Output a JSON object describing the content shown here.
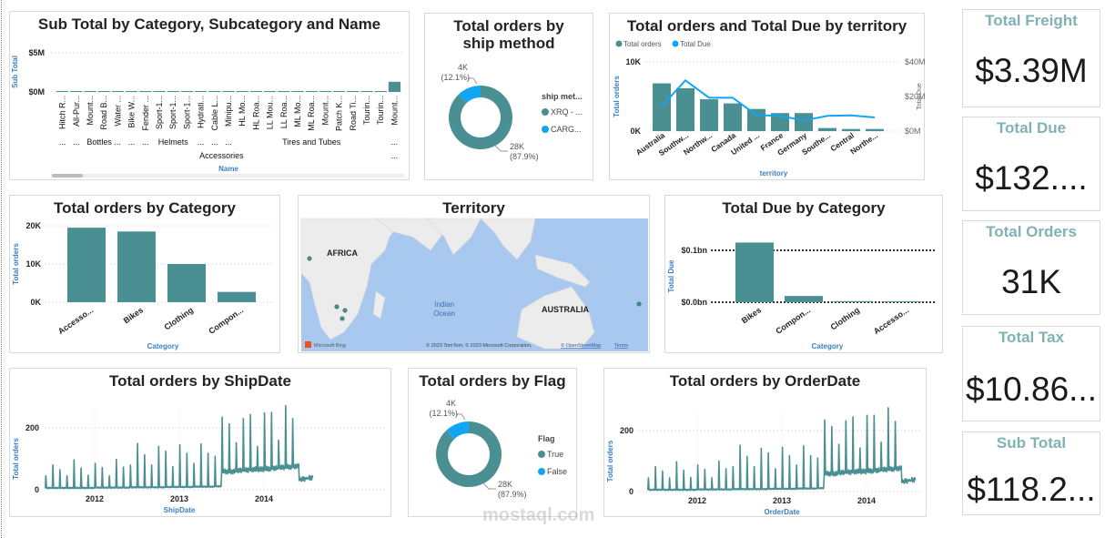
{
  "colors": {
    "teal": "#4a8f92",
    "blue": "#12a5f4",
    "title": "#252423",
    "axis_title": "#3b7fc4",
    "kpi_title": "#7fb2b4",
    "map_water": "#a9c8f0",
    "map_land": "#ececec"
  },
  "subtotal": {
    "title": "Sub Total by Category, Subcategory and Name",
    "y_title": "Sub Total",
    "x_title": "Name",
    "y_ticks": [
      "$5M",
      "$0M"
    ],
    "chart_data": {
      "type": "bar",
      "ylim": [
        0,
        5000000
      ],
      "categories": [
        "Hitch R...",
        "All-Pur...",
        "Mount...",
        "Road B...",
        "Water ...",
        "Bike W...",
        "Fender ...",
        "Sport-1...",
        "Sport-1...",
        "Sport-1...",
        "Hydrati...",
        "Cable L...",
        "Minipu...",
        "HL Mo...",
        "HL Roa...",
        "LL Mou...",
        "LL Roa...",
        "ML Mo...",
        "ML Roa...",
        "Mount...",
        "Patch K...",
        "Road Ti...",
        "Tourin...",
        "Tourin...",
        "Mount..."
      ],
      "values": [
        90000,
        10000,
        10000,
        10000,
        10000,
        10000,
        10000,
        50000,
        50000,
        50000,
        30000,
        10000,
        10000,
        10000,
        10000,
        10000,
        10000,
        10000,
        10000,
        10000,
        10000,
        10000,
        10000,
        10000,
        1300000
      ]
    },
    "subcategories": [
      {
        "label": "...",
        "span": 1
      },
      {
        "label": "...",
        "span": 1
      },
      {
        "label": "Bottles ...",
        "span": 3
      },
      {
        "label": "...",
        "span": 1
      },
      {
        "label": "...",
        "span": 1
      },
      {
        "label": "Helmets",
        "span": 3
      },
      {
        "label": "...",
        "span": 1
      },
      {
        "label": "...",
        "span": 1
      },
      {
        "label": "...",
        "span": 1
      },
      {
        "label": "Tires and Tubes",
        "span": 11
      },
      {
        "label": "...",
        "span": 1
      }
    ],
    "groups": [
      {
        "label": "Accessories",
        "span": 24
      },
      {
        "label": "...",
        "span": 1
      }
    ]
  },
  "ship_method": {
    "title": "Total orders by ship method",
    "legend_title": "ship met...",
    "chart_data": {
      "type": "pie",
      "slices": [
        {
          "name": "XRQ - ...",
          "value": 28000,
          "percent": 87.9,
          "label": "28K",
          "pct_label": "(87.9%)"
        },
        {
          "name": "CARG...",
          "value": 4000,
          "percent": 12.1,
          "label": "4K",
          "pct_label": "(12.1%)"
        }
      ]
    }
  },
  "territory_combo": {
    "title": "Total orders and Total Due by territory",
    "legend": [
      "Total orders",
      "Total Due"
    ],
    "y_title": "Total orders",
    "y2_title": "Total Due",
    "x_title": "territory",
    "y_ticks": [
      "10K",
      "0K"
    ],
    "y2_ticks": [
      "$40M",
      "$20M",
      "$0M"
    ],
    "chart_data": {
      "type": "bar",
      "ylim": [
        0,
        10000
      ],
      "y2lim": [
        0,
        40000000
      ],
      "categories": [
        "Australia",
        "Southw...",
        "Northw...",
        "Canada",
        "United ...",
        "France",
        "Germany",
        "Southe...",
        "Central",
        "Northe..."
      ],
      "series": [
        {
          "name": "Total orders",
          "type": "bar",
          "values": [
            6900,
            6200,
            4600,
            4000,
            3200,
            2600,
            2600,
            440,
            300,
            300
          ]
        },
        {
          "name": "Total Due",
          "type": "line",
          "values": [
            14400000,
            29300000,
            19300000,
            19300000,
            9300000,
            8800000,
            6100000,
            8800000,
            9100000,
            7900000
          ]
        }
      ]
    }
  },
  "kpis": [
    {
      "title": "Total Freight",
      "value": "$3.39M"
    },
    {
      "title": "Total Due",
      "value": "$132...."
    },
    {
      "title": "Total Orders",
      "value": "31K"
    },
    {
      "title": "Total Tax",
      "value": "$10.86..."
    },
    {
      "title": "Sub Total",
      "value": "$118.2..."
    }
  ],
  "orders_category": {
    "title": "Total orders by Category",
    "y_title": "Total orders",
    "x_title": "Category",
    "y_ticks": [
      "20K",
      "10K",
      "0K"
    ],
    "chart_data": {
      "type": "bar",
      "ylim": [
        0,
        20000
      ],
      "categories": [
        "Accesso...",
        "Bikes",
        "Clothing",
        "Compon..."
      ],
      "values": [
        19500,
        18500,
        10000,
        2700
      ]
    }
  },
  "map": {
    "title": "Territory",
    "labels": {
      "africa": "AFRICA",
      "ocean_1": "Indian",
      "ocean_2": "Ocean",
      "australia": "AUSTRALIA"
    },
    "bing": "Microsoft Bing",
    "copyright": "© 2023 TomTom, © 2023 Microsoft Corporation,",
    "osm": "© OpenStreetMap",
    "terms": "Terms"
  },
  "due_category": {
    "title": "Total Due by Category",
    "y_title": "Total Due",
    "x_title": "Category",
    "y_ticks": [
      "$0.1bn",
      "$0.0bn"
    ],
    "chart_data": {
      "type": "bar",
      "ylim": [
        0,
        0.1
      ],
      "unit": "bn",
      "categories": [
        "Bikes",
        "Compon...",
        "Clothing",
        "Accesso..."
      ],
      "values": [
        0.115,
        0.012,
        0.002,
        0.001
      ]
    }
  },
  "shipdate": {
    "title": "Total orders by ShipDate",
    "y_title": "Total orders",
    "x_title": "ShipDate",
    "y_ticks": [
      "200",
      "0"
    ],
    "x_ticks": [
      "2012",
      "2013",
      "2014"
    ],
    "chart_data": {
      "type": "line",
      "xlim": [
        "2011-06",
        "2014-07"
      ],
      "ylim": [
        0,
        200
      ],
      "months": [
        "2011-06",
        "2011-07",
        "2011-08",
        "2011-09",
        "2011-10",
        "2011-11",
        "2011-12",
        "2012-01",
        "2012-02",
        "2012-03",
        "2012-04",
        "2012-05",
        "2012-06",
        "2012-07",
        "2012-08",
        "2012-09",
        "2012-10",
        "2012-11",
        "2012-12",
        "2013-01",
        "2013-02",
        "2013-03",
        "2013-04",
        "2013-05",
        "2013-06",
        "2013-07",
        "2013-08",
        "2013-09",
        "2013-10",
        "2013-11",
        "2013-12",
        "2014-01",
        "2014-02",
        "2014-03",
        "2014-04",
        "2014-05",
        "2014-06",
        "2014-07"
      ],
      "monthly_peak": [
        45,
        80,
        65,
        45,
        97,
        70,
        47,
        85,
        72,
        45,
        98,
        73,
        80,
        150,
        113,
        80,
        140,
        125,
        75,
        145,
        118,
        85,
        148,
        118,
        108,
        235,
        213,
        152,
        230,
        243,
        140,
        248,
        250,
        160,
        272,
        230,
        40,
        40
      ],
      "daily_baseline": [
        5,
        5,
        5,
        5,
        5,
        5,
        5,
        6,
        6,
        6,
        6,
        6,
        7,
        7,
        7,
        7,
        7,
        8,
        8,
        8,
        8,
        9,
        9,
        9,
        10,
        55,
        55,
        58,
        60,
        62,
        62,
        64,
        66,
        68,
        70,
        72,
        30,
        35
      ]
    }
  },
  "flag": {
    "title": "Total orders by Flag",
    "legend_title": "Flag",
    "chart_data": {
      "type": "pie",
      "slices": [
        {
          "name": "True",
          "value": 28000,
          "percent": 87.9,
          "label": "28K",
          "pct_label": "(87.9%)"
        },
        {
          "name": "False",
          "value": 4000,
          "percent": 12.1,
          "label": "4K",
          "pct_label": "(12.1%)"
        }
      ]
    }
  },
  "orderdate": {
    "title": "Total orders by OrderDate",
    "y_title": "Total orders",
    "x_title": "OrderDate",
    "y_ticks": [
      "200",
      "0"
    ],
    "x_ticks": [
      "2012",
      "2013",
      "2014"
    ],
    "chart_data": {
      "type": "line",
      "xlim": [
        "2011-06",
        "2014-07"
      ],
      "ylim": [
        0,
        200
      ],
      "months": [
        "2011-06",
        "2011-07",
        "2011-08",
        "2011-09",
        "2011-10",
        "2011-11",
        "2011-12",
        "2012-01",
        "2012-02",
        "2012-03",
        "2012-04",
        "2012-05",
        "2012-06",
        "2012-07",
        "2012-08",
        "2012-09",
        "2012-10",
        "2012-11",
        "2012-12",
        "2013-01",
        "2013-02",
        "2013-03",
        "2013-04",
        "2013-05",
        "2013-06",
        "2013-07",
        "2013-08",
        "2013-09",
        "2013-10",
        "2013-11",
        "2013-12",
        "2014-01",
        "2014-02",
        "2014-03",
        "2014-04",
        "2014-05",
        "2014-06",
        "2014-07"
      ],
      "monthly_peak": [
        45,
        82,
        67,
        45,
        98,
        70,
        47,
        87,
        73,
        45,
        100,
        75,
        82,
        152,
        115,
        82,
        142,
        127,
        75,
        145,
        118,
        87,
        150,
        118,
        110,
        235,
        213,
        155,
        232,
        245,
        143,
        250,
        250,
        162,
        275,
        230,
        40,
        40
      ],
      "daily_baseline": [
        5,
        5,
        5,
        5,
        5,
        5,
        5,
        6,
        6,
        6,
        6,
        6,
        7,
        7,
        7,
        7,
        7,
        8,
        8,
        8,
        8,
        9,
        9,
        9,
        10,
        55,
        55,
        58,
        60,
        62,
        62,
        64,
        66,
        68,
        70,
        72,
        30,
        35
      ]
    }
  },
  "watermark": "mostaql.com"
}
